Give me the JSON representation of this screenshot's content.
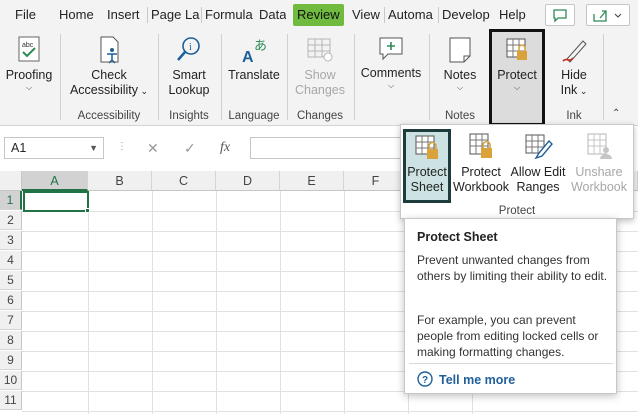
{
  "tabs": [
    "File",
    "Home",
    "Insert",
    "Page La",
    "Formula",
    "Data",
    "Review",
    "View",
    "Automa",
    "Develop",
    "Help"
  ],
  "active_tab": "Review",
  "ribbon": {
    "proofing": "Proofing",
    "check_line1": "Check",
    "check_line2": "Accessibility",
    "smart_line1": "Smart",
    "smart_line2": "Lookup",
    "translate": "Translate",
    "show_line1": "Show",
    "show_line2": "Changes",
    "comments": "Comments",
    "notes": "Notes",
    "protect": "Protect",
    "hide_line1": "Hide",
    "hide_line2": "Ink",
    "groups": {
      "accessibility": "Accessibility",
      "insights": "Insights",
      "language": "Language",
      "changes": "Changes",
      "notes": "Notes",
      "ink": "Ink"
    }
  },
  "formula_bar": {
    "name_box": "A1",
    "fx": "fx",
    "cancel": "✕",
    "enter": "✓"
  },
  "grid": {
    "columns": [
      "A",
      "B",
      "C",
      "D",
      "E",
      "F"
    ],
    "rows": [
      "1",
      "2",
      "3",
      "4",
      "5",
      "6",
      "7",
      "8",
      "9",
      "10",
      "11"
    ]
  },
  "protect_menu": {
    "sheet_line1": "Protect",
    "sheet_line2": "Sheet",
    "workbook_line1": "Protect",
    "workbook_line2": "Workbook",
    "ranges_line1": "Allow Edit",
    "ranges_line2": "Ranges",
    "unshare_line1": "Unshare",
    "unshare_line2": "Workbook",
    "group_label": "Protect"
  },
  "tooltip": {
    "title": "Protect Sheet",
    "para1": "Prevent unwanted changes from others by limiting their ability to edit.",
    "para2": "For example, you can prevent people from editing locked cells or making formatting changes.",
    "help": "Tell me more"
  },
  "colors": {
    "accent_green": "#217346",
    "active_tab": "#6fba3f",
    "lock_gold": "#d9a23a",
    "help_link": "#1f5f9a"
  }
}
